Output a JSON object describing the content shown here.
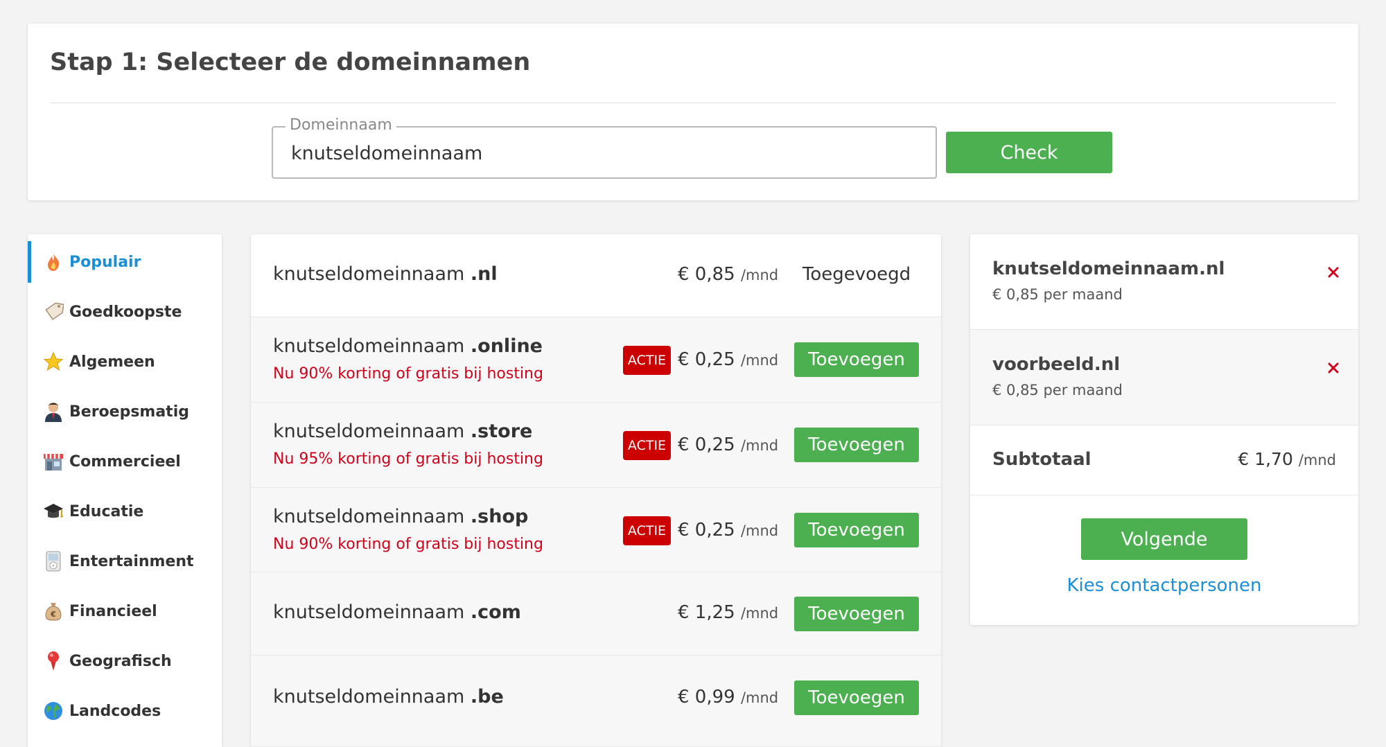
{
  "header": {
    "title": "Stap 1: Selecteer de domeinnamen",
    "domain_legend": "Domeinnaam",
    "domain_value": "knutseldomeinnaam",
    "check_label": "Check"
  },
  "sidebar": {
    "items": [
      {
        "label": "Populair",
        "icon": "flame-icon",
        "active": true
      },
      {
        "label": "Goedkoopste",
        "icon": "price-tag-icon"
      },
      {
        "label": "Algemeen",
        "icon": "star-icon"
      },
      {
        "label": "Beroepsmatig",
        "icon": "businessman-icon"
      },
      {
        "label": "Commercieel",
        "icon": "shop-icon"
      },
      {
        "label": "Educatie",
        "icon": "graduation-cap-icon"
      },
      {
        "label": "Entertainment",
        "icon": "music-player-icon"
      },
      {
        "label": "Financieel",
        "icon": "money-bag-icon"
      },
      {
        "label": "Geografisch",
        "icon": "map-pin-icon"
      },
      {
        "label": "Landcodes",
        "icon": "globe-icon"
      }
    ]
  },
  "results": {
    "rows": [
      {
        "name": "knutseldomeinnaam ",
        "tld": ".nl",
        "price": "€ 0,85",
        "unit": "/mnd",
        "status": "Toegevoegd",
        "promo": "",
        "actie": ""
      },
      {
        "name": "knutseldomeinnaam ",
        "tld": ".online",
        "price": "€ 0,25",
        "unit": "/mnd",
        "action": "Toevoegen",
        "promo": "Nu 90% korting of gratis bij hosting",
        "actie": "ACTIE"
      },
      {
        "name": "knutseldomeinnaam ",
        "tld": ".store",
        "price": "€ 0,25",
        "unit": "/mnd",
        "action": "Toevoegen",
        "promo": "Nu 95% korting of gratis bij hosting",
        "actie": "ACTIE"
      },
      {
        "name": "knutseldomeinnaam ",
        "tld": ".shop",
        "price": "€ 0,25",
        "unit": "/mnd",
        "action": "Toevoegen",
        "promo": "Nu 90% korting of gratis bij hosting",
        "actie": "ACTIE"
      },
      {
        "name": "knutseldomeinnaam ",
        "tld": ".com",
        "price": "€ 1,25",
        "unit": "/mnd",
        "action": "Toevoegen",
        "promo": "",
        "actie": ""
      },
      {
        "name": "knutseldomeinnaam ",
        "tld": ".be",
        "price": "€ 0,99",
        "unit": "/mnd",
        "action": "Toevoegen",
        "promo": "",
        "actie": ""
      }
    ]
  },
  "cart": {
    "items": [
      {
        "name": "knutseldomeinnaam.nl",
        "price": "€ 0,85 per maand"
      },
      {
        "name": "voorbeeld.nl",
        "price": "€ 0,85 per maand"
      }
    ],
    "subtotal_label": "Subtotaal",
    "subtotal_value": "€ 1,70",
    "subtotal_unit": "/mnd",
    "next_label": "Volgende",
    "contacts_link": "Kies contactpersonen"
  },
  "colors": {
    "accent_blue": "#1a8fd6",
    "button_green": "#4caf50",
    "promo_red": "#d0021b",
    "actie_red": "#cc0000"
  }
}
